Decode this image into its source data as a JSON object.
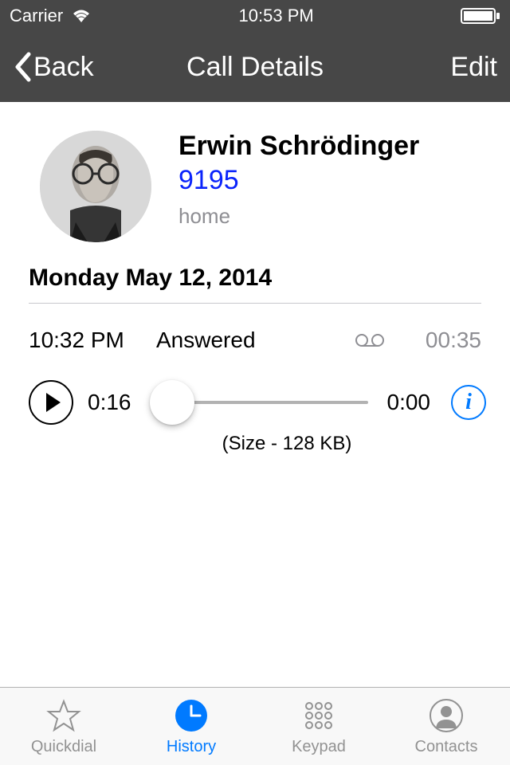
{
  "status": {
    "carrier": "Carrier",
    "time": "10:53 PM"
  },
  "nav": {
    "back": "Back",
    "title": "Call Details",
    "edit": "Edit"
  },
  "contact": {
    "name": "Erwin Schrödinger",
    "number": "9195",
    "label": "home"
  },
  "date_heading": "Monday May 12, 2014",
  "call": {
    "time": "10:32 PM",
    "status": "Answered",
    "duration": "00:35"
  },
  "player": {
    "elapsed": "0:16",
    "remaining": "0:00",
    "size": "(Size - 128 KB)"
  },
  "tabs": {
    "quickdial": "Quickdial",
    "history": "History",
    "keypad": "Keypad",
    "contacts": "Contacts"
  }
}
